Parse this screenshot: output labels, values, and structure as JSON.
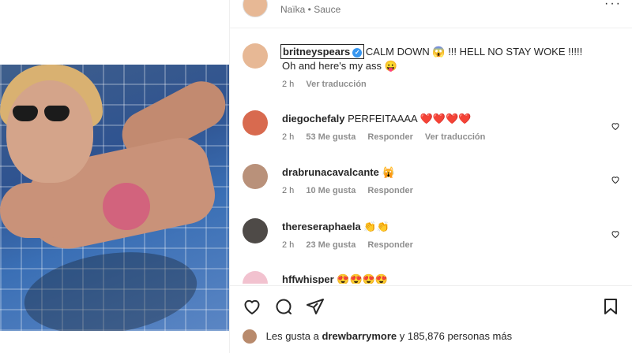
{
  "header": {
    "subtitle": "Naïka • Sauce",
    "more_label": "···"
  },
  "post": {
    "user": "britneyspears",
    "verified_glyph": "✓",
    "caption_line1": "CALM DOWN 😱 !!! HELL NO STAY WOKE !!!!!",
    "caption_line2": "Oh and here's my ass 😛",
    "time": "2 h",
    "translate": "Ver traducción"
  },
  "comments": [
    {
      "user": "diegochefaly",
      "text": "PERFEITAAAA ❤️❤️❤️❤️",
      "time": "2 h",
      "likes": "53 Me gusta",
      "reply": "Responder",
      "translate": "Ver traducción",
      "avatar_color": "#d86a4f"
    },
    {
      "user": "drabrunacavalcante",
      "text": "🙀",
      "time": "2 h",
      "likes": "10 Me gusta",
      "reply": "Responder",
      "avatar_color": "#b9917a"
    },
    {
      "user": "thereseraphaela",
      "text": "👏👏",
      "time": "2 h",
      "likes": "23 Me gusta",
      "reply": "Responder",
      "avatar_color": "#4e4a47"
    },
    {
      "user": "hffwhisper",
      "text": "😍😍😍😍",
      "avatar_color": "#f2c2cf"
    }
  ],
  "likes": {
    "prefix": "Les gusta a",
    "user": "drewbarrymore",
    "suffix": "y 185,876 personas más"
  },
  "icons": [
    "heart-icon",
    "comment-icon",
    "share-icon",
    "bookmark-icon",
    "more-icon"
  ],
  "colors": {
    "verified": "#3897f0",
    "muted": "#737373",
    "text": "#262626"
  }
}
